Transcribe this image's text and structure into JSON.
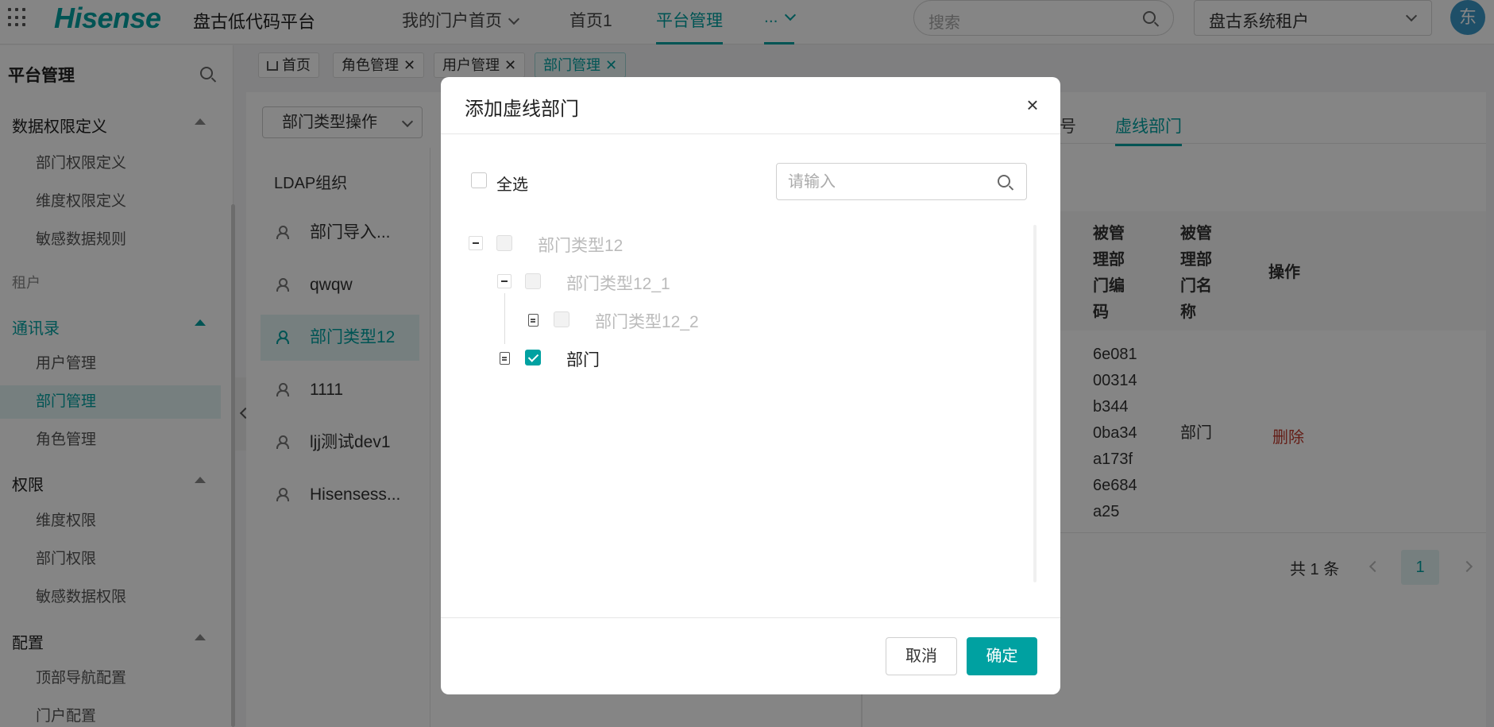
{
  "header": {
    "logo": "Hisense",
    "platform_name": "盘古低代码平台",
    "nav": [
      {
        "label": "我的门户首页"
      },
      {
        "label": "首页1"
      },
      {
        "label": "平台管理"
      },
      {
        "label": "..."
      }
    ],
    "search_placeholder": "搜索",
    "tenant": "盘古系统租户",
    "avatar_text": "东"
  },
  "sidebar": {
    "title": "平台管理",
    "groups": [
      {
        "label": "数据权限定义",
        "items": [
          "部门权限定义",
          "维度权限定义",
          "敏感数据规则"
        ]
      },
      {
        "label": "租户"
      },
      {
        "label": "通讯录",
        "items": [
          "用户管理",
          "部门管理",
          "角色管理"
        ]
      },
      {
        "label": "权限",
        "items": [
          "维度权限",
          "部门权限",
          "敏感数据权限"
        ]
      },
      {
        "label": "配置",
        "items": [
          "顶部导航配置",
          "门户配置"
        ]
      }
    ]
  },
  "tabs": [
    {
      "label": "首页"
    },
    {
      "label": "角色管理"
    },
    {
      "label": "用户管理"
    },
    {
      "label": "部门管理"
    }
  ],
  "content": {
    "dept_op_label": "部门类型操作",
    "org_title": "LDAP组织",
    "org_items": [
      "部门导入...",
      "qwqw",
      "部门类型12",
      "1111",
      "ljj测试dev1",
      "Hisensess..."
    ],
    "right_tabs": [
      "号",
      "虚线部门"
    ],
    "table": {
      "headers": [
        [
          "被管",
          "理部",
          "门编",
          "码"
        ],
        [
          "被管",
          "理部",
          "门名",
          "称"
        ],
        [
          "操作"
        ]
      ],
      "row": {
        "code_lines": [
          "6e081",
          "00314",
          "b344",
          "0ba34",
          "a173f",
          "6e684",
          "a25"
        ],
        "name": "部门",
        "action": "删除"
      }
    },
    "pager": {
      "total": "共 1 条",
      "page": "1"
    }
  },
  "modal": {
    "title": "添加虚线部门",
    "close": "×",
    "select_all": "全选",
    "search_placeholder": "请输入",
    "tree": [
      {
        "label": "部门类型12"
      },
      {
        "label": "部门类型12_1"
      },
      {
        "label": "部门类型12_2"
      },
      {
        "label": "部门"
      }
    ],
    "cancel": "取消",
    "confirm": "确定"
  },
  "colors": {
    "accent": "#00a1a1",
    "danger": "#c0392b",
    "avatar": "#3a98c8"
  }
}
